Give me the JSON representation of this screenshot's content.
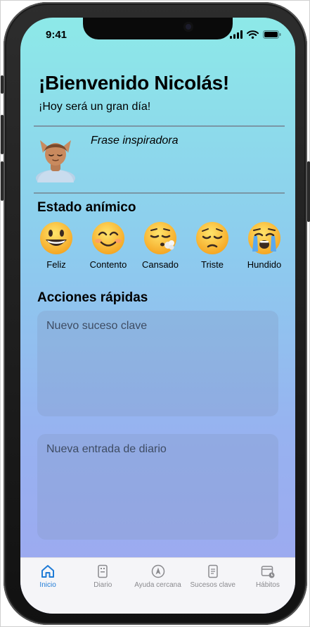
{
  "status_bar": {
    "time": "9:41"
  },
  "header": {
    "title": "¡Bienvenido Nicolás!",
    "subtitle": "¡Hoy será un gran día!"
  },
  "quote": {
    "label": "Frase inspiradora",
    "avatar_icon": "person-meditating-emoji"
  },
  "mood": {
    "title": "Estado anímico",
    "options": [
      {
        "label": "Feliz",
        "icon": "grinning-face-emoji"
      },
      {
        "label": "Contento",
        "icon": "smiling-face-emoji"
      },
      {
        "label": "Cansado",
        "icon": "tired-exhaling-face-emoji"
      },
      {
        "label": "Triste",
        "icon": "pensive-face-emoji"
      },
      {
        "label": "Hundido",
        "icon": "crying-face-emoji"
      }
    ]
  },
  "actions": {
    "title": "Acciones rápidas",
    "items": [
      {
        "placeholder": "Nuevo suceso clave"
      },
      {
        "placeholder": "Nueva entrada de diario"
      }
    ]
  },
  "tabbar": {
    "active_color": "#1f7bd6",
    "items": [
      {
        "label": "Inicio",
        "icon": "house-icon",
        "active": true
      },
      {
        "label": "Diario",
        "icon": "journal-icon",
        "active": false
      },
      {
        "label": "Ayuda cercana",
        "icon": "compass-icon",
        "active": false
      },
      {
        "label": "Sucesos clave",
        "icon": "document-icon",
        "active": false
      },
      {
        "label": "Hábitos",
        "icon": "calendar-icon",
        "active": false
      }
    ]
  }
}
